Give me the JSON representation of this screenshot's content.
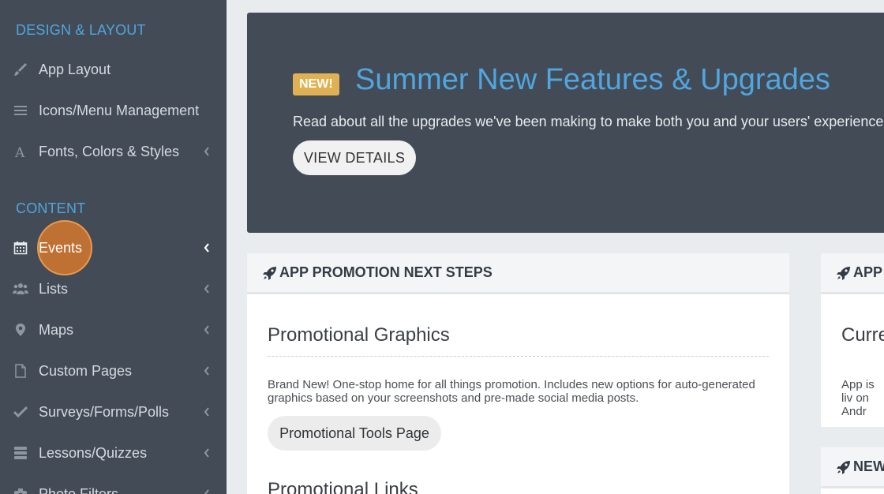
{
  "sidebar": {
    "design_section": "DESIGN & LAYOUT",
    "content_section": "CONTENT",
    "design_items": [
      {
        "label": "App Layout",
        "icon": "paintbrush-icon"
      },
      {
        "label": "Icons/Menu Management",
        "icon": "menu-lines-icon"
      },
      {
        "label": "Fonts, Colors & Styles",
        "icon": "font-icon"
      }
    ],
    "content_items": [
      {
        "label": "Events",
        "icon": "calendar-icon",
        "active": true
      },
      {
        "label": "Lists",
        "icon": "users-icon"
      },
      {
        "label": "Maps",
        "icon": "map-pin-icon"
      },
      {
        "label": "Custom Pages",
        "icon": "file-icon"
      },
      {
        "label": "Surveys/Forms/Polls",
        "icon": "check-icon"
      },
      {
        "label": "Lessons/Quizzes",
        "icon": "stack-icon"
      },
      {
        "label": "Photo Filters",
        "icon": "camera-icon"
      }
    ]
  },
  "banner": {
    "badge": "NEW!",
    "title": "Summer New Features & Upgrades",
    "description": "Read about all the upgrades we've been making to make both you and your users' experience even",
    "button": "VIEW DETAILS"
  },
  "promotion_card": {
    "header": "APP PROMOTION NEXT STEPS",
    "graphics_title": "Promotional Graphics",
    "graphics_text": "Brand New! One-stop home for all things promotion. Includes new options for auto-generated graphics based on your screenshots and pre-made social media posts.",
    "tools_button": "Promotional Tools Page",
    "links_title": "Promotional Links"
  },
  "status_card": {
    "header": "APP S",
    "title": "Curre",
    "text": "App is liv on Andr"
  },
  "news_card": {
    "header": "NEW"
  },
  "colors": {
    "sidebar_bg": "#434b56",
    "accent_blue": "#4fa6e0",
    "badge_gold": "#e0b153",
    "highlight_orange": "#d3782c"
  }
}
